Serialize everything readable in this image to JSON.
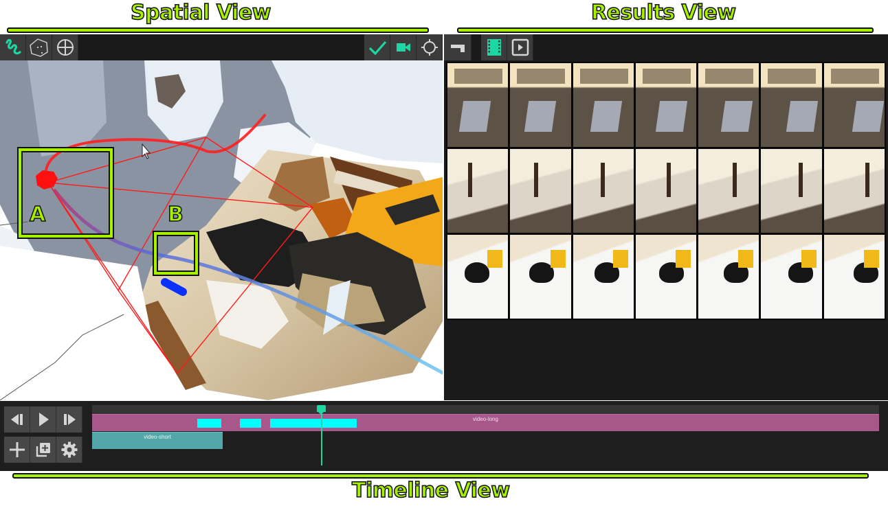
{
  "captions": {
    "spatial": "Spatial View",
    "results": "Results View",
    "timeline": "Timeline View"
  },
  "colors": {
    "caption_green": "#a6f000",
    "accent_teal": "#1ed6a4",
    "icon_gray": "#d6d6d6",
    "track_long": "#a8578a",
    "track_short": "#52a6aa",
    "segment_cyan": "#00ffff",
    "trajectory_red": "#ff1a1a",
    "trajectory_blue": "#1a40ff"
  },
  "spatial": {
    "toolbar_left": [
      {
        "name": "draw-path-tool",
        "icon": "squiggle-icon",
        "active": true
      },
      {
        "name": "polygon-select-tool",
        "icon": "polygon-icon",
        "active": false
      },
      {
        "name": "crosshair-tool",
        "icon": "crosshair-circle-icon",
        "active": false
      }
    ],
    "toolbar_right": [
      {
        "name": "confirm-button",
        "icon": "check-icon",
        "active": true
      },
      {
        "name": "camera-button",
        "icon": "video-camera-icon",
        "active": true
      },
      {
        "name": "target-button",
        "icon": "target-icon",
        "active": false
      }
    ],
    "markers": [
      {
        "label": "A",
        "description": "camera position (red)"
      },
      {
        "label": "B",
        "description": "query point (blue)"
      }
    ]
  },
  "results": {
    "toolbar": [
      {
        "name": "collapse-button",
        "icon": "corner-icon",
        "active": false
      },
      {
        "name": "filmstrip-view-button",
        "icon": "film-icon",
        "active": true
      },
      {
        "name": "play-view-button",
        "icon": "play-box-icon",
        "active": false
      }
    ],
    "thumbnails": [
      {
        "row": 1,
        "scene": "living room sofa coffee table"
      },
      {
        "row": 1,
        "scene": "living room coffee table"
      },
      {
        "row": 1,
        "scene": "coffee table with dog"
      },
      {
        "row": 1,
        "scene": "coffee table with dog"
      },
      {
        "row": 1,
        "scene": "dog on carpet"
      },
      {
        "row": 1,
        "scene": "dog near cabinet"
      },
      {
        "row": 1,
        "scene": "dog near cabinet"
      },
      {
        "row": 2,
        "scene": "hallway dog"
      },
      {
        "row": 2,
        "scene": "hallway dog"
      },
      {
        "row": 2,
        "scene": "dining area hallway"
      },
      {
        "row": 2,
        "scene": "dining area hallway"
      },
      {
        "row": 2,
        "scene": "dining table chairs"
      },
      {
        "row": 2,
        "scene": "dining table chairs"
      },
      {
        "row": 2,
        "scene": "dining table chairs"
      },
      {
        "row": 3,
        "scene": "dining table corner"
      },
      {
        "row": 3,
        "scene": "table with cap"
      },
      {
        "row": 3,
        "scene": "table with cap"
      },
      {
        "row": 3,
        "scene": "table with cap top"
      },
      {
        "row": 3,
        "scene": "table with cap top"
      },
      {
        "row": 3,
        "scene": "table with cap top"
      },
      {
        "row": 3,
        "scene": "table with cap close"
      }
    ]
  },
  "timeline": {
    "controls": [
      {
        "name": "step-back-button",
        "icon": "step-back-icon"
      },
      {
        "name": "play-button",
        "icon": "play-icon"
      },
      {
        "name": "step-forward-button",
        "icon": "step-forward-icon"
      },
      {
        "name": "add-button",
        "icon": "plus-icon"
      },
      {
        "name": "add-layer-button",
        "icon": "add-layer-icon"
      },
      {
        "name": "settings-button",
        "icon": "gear-icon"
      }
    ],
    "tracks": [
      {
        "label": "video-long",
        "start": 0.0,
        "end": 1.0
      },
      {
        "label": "video-short",
        "start": 0.0,
        "end": 0.166
      }
    ],
    "segments": [
      {
        "start": 0.134,
        "end": 0.164
      },
      {
        "start": 0.188,
        "end": 0.215
      },
      {
        "start": 0.226,
        "end": 0.336
      }
    ],
    "playhead_position": 0.291
  }
}
